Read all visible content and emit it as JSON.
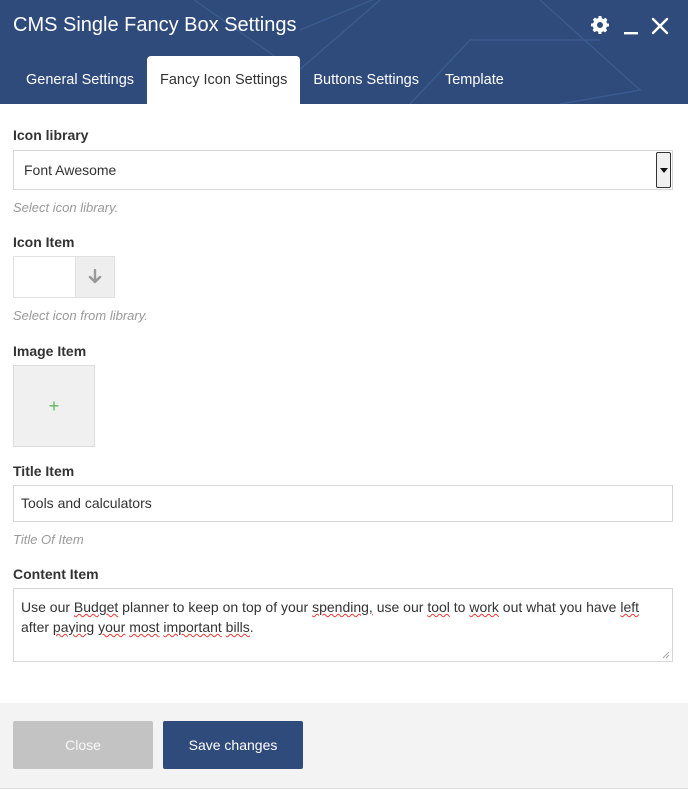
{
  "window": {
    "title": "CMS Single Fancy Box Settings"
  },
  "tabs": [
    {
      "label": "General Settings",
      "active": false
    },
    {
      "label": "Fancy Icon Settings",
      "active": true
    },
    {
      "label": "Buttons Settings",
      "active": false
    },
    {
      "label": "Template",
      "active": false
    }
  ],
  "fields": {
    "icon_library": {
      "label": "Icon library",
      "value": "Font Awesome",
      "help": "Select icon library."
    },
    "icon_item": {
      "label": "Icon Item",
      "help": "Select icon from library.",
      "button_icon": "arrow-down-icon"
    },
    "image_item": {
      "label": "Image Item",
      "add_glyph": "+"
    },
    "title_item": {
      "label": "Title Item",
      "value": "Tools and calculators",
      "help": "Title Of Item"
    },
    "content_item": {
      "label": "Content Item",
      "value_words": [
        "Use our ",
        "Budget",
        " planner to keep on top of your ",
        "spending,",
        " use our ",
        "tool",
        " to ",
        "work",
        " out what you have ",
        "left",
        " after ",
        "paying",
        " ",
        "your",
        " ",
        "most",
        " ",
        "important",
        " ",
        "bills",
        "."
      ]
    }
  },
  "footer": {
    "close_label": "Close",
    "save_label": "Save changes"
  },
  "colors": {
    "header": "#2f4b7c",
    "save_button": "#2f4b7c",
    "close_button": "#c3c3c3",
    "add_plus": "#5cb85c"
  }
}
